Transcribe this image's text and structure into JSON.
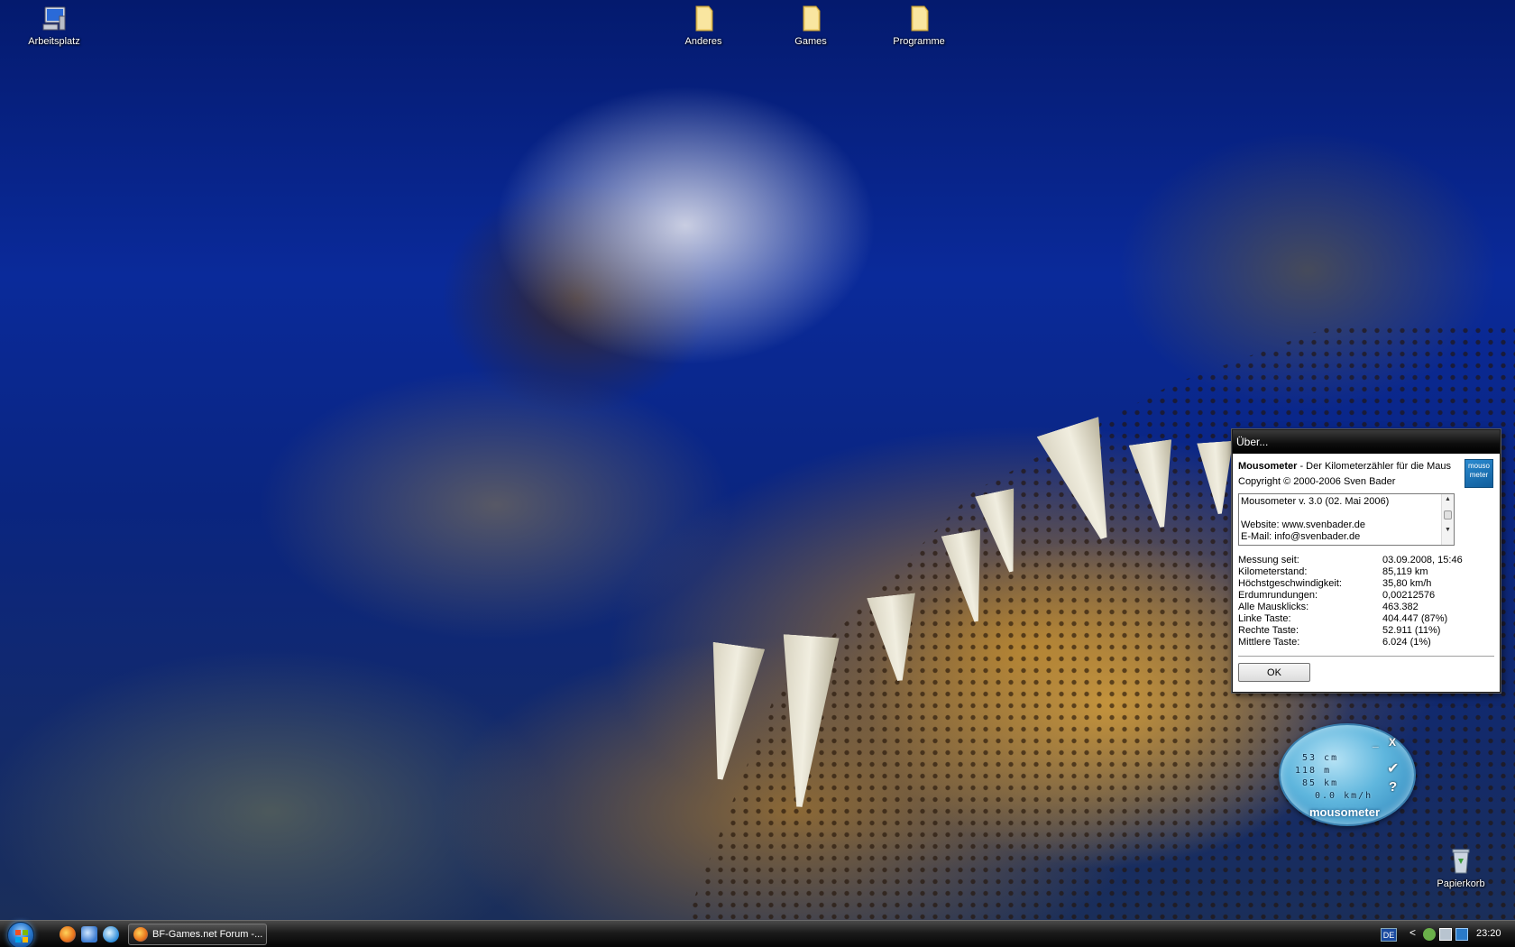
{
  "desktop": {
    "icons": [
      {
        "label": "Arbeitsplatz",
        "icon": "computer-icon"
      },
      {
        "label": "Anderes",
        "icon": "folder-icon"
      },
      {
        "label": "Games",
        "icon": "folder-icon"
      },
      {
        "label": "Programme",
        "icon": "folder-icon"
      },
      {
        "label": "Papierkorb",
        "icon": "recycle-bin-icon"
      }
    ]
  },
  "about_dialog": {
    "title": "Über...",
    "app_name": "Mousometer",
    "tagline": " - Der Kilometerzähler für die Maus",
    "copyright": "Copyright © 2000-2006 Sven Bader",
    "logo_text": [
      "mouso",
      "meter"
    ],
    "textbox_lines": [
      "Mousometer v. 3.0 (02. Mai 2006)",
      "",
      "Website: www.svenbader.de",
      "E-Mail: info@svenbader.de"
    ],
    "stats": [
      {
        "label": "Messung seit:",
        "value": "03.09.2008, 15:46"
      },
      {
        "label": "Kilometerstand:",
        "value": "85,119 km"
      },
      {
        "label": "Höchstgeschwindigkeit:",
        "value": "35,80 km/h"
      },
      {
        "label": "Erdumrundungen:",
        "value": "0,00212576"
      },
      {
        "label": "Alle Mausklicks:",
        "value": "463.382"
      },
      {
        "label": "Linke Taste:",
        "value": "404.447 (87%)"
      },
      {
        "label": "Rechte Taste:",
        "value": "52.911 (11%)"
      },
      {
        "label": "Mittlere Taste:",
        "value": "6.024 (1%)"
      }
    ],
    "ok_label": "OK"
  },
  "mousometer_widget": {
    "readouts": [
      "53 cm",
      "118 m",
      "85 km",
      "0.0 km/h"
    ],
    "label": "mousometer",
    "minimize": "_",
    "close": "X",
    "check": "✔",
    "help": "?"
  },
  "taskbar": {
    "task_button": "BF-Games.net Forum -...",
    "language": "DE",
    "chevron": "<",
    "clock": "23:20"
  },
  "colors": {
    "taskbar": "#1b1b1b",
    "dialog_titlebar": "#0c0c0c",
    "widget_blue": "#5fb6dd"
  }
}
